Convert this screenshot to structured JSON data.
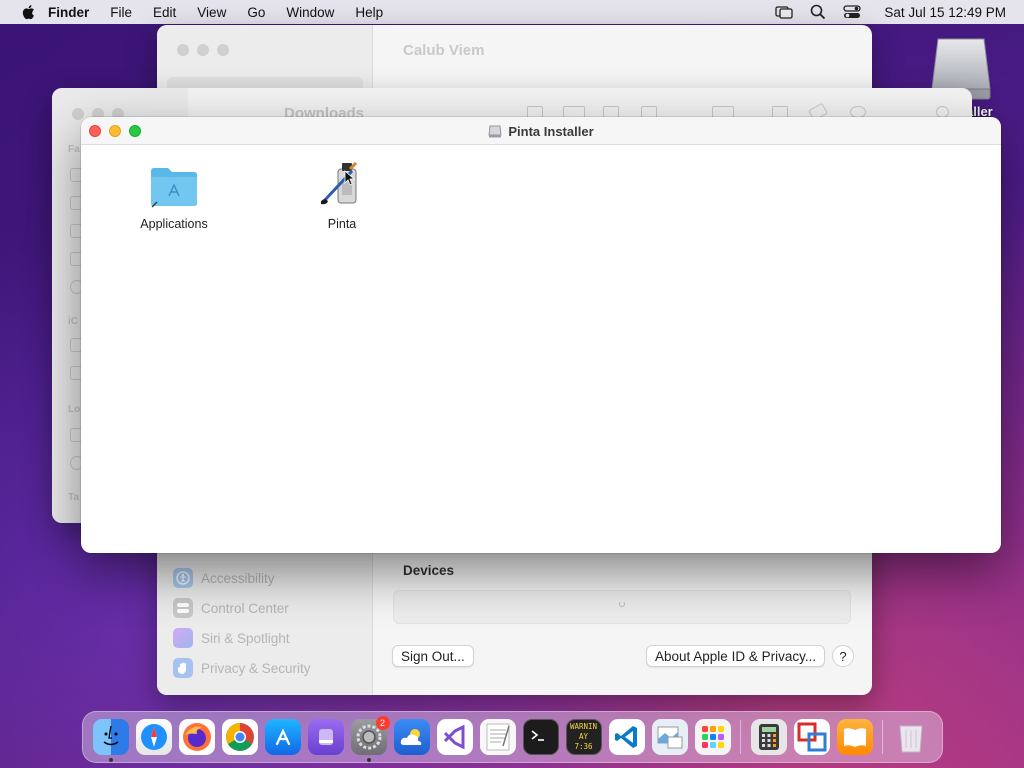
{
  "menubar": {
    "app_name": "Finder",
    "items": [
      "File",
      "Edit",
      "View",
      "Go",
      "Window",
      "Help"
    ],
    "clock": "Sat Jul 15  12:49 PM",
    "status_icons": [
      "screen-mirroring-icon",
      "spotlight-search-icon",
      "control-center-icon"
    ]
  },
  "desktop": {
    "drive_label": "aller"
  },
  "settings_window": {
    "title": "Calub Viem",
    "sidebar_items": [
      {
        "label": "Accessibility",
        "icon": "accessibility-icon",
        "color": "#4a90e2"
      },
      {
        "label": "Control Center",
        "icon": "control-center-icon",
        "color": "#8e8e93"
      },
      {
        "label": "Siri & Spotlight",
        "icon": "siri-icon",
        "color": "#b061e8"
      },
      {
        "label": "Privacy & Security",
        "icon": "hand-icon",
        "color": "#3a7ee8"
      }
    ],
    "devices_label": "Devices",
    "sign_out_label": "Sign Out...",
    "about_label": "About Apple ID & Privacy...",
    "help_label": "?"
  },
  "finder_window": {
    "title": "Downloads",
    "section_labels": [
      "Fa",
      "iC",
      "Lo",
      "Ta"
    ]
  },
  "installer_window": {
    "title": "Pinta Installer",
    "items": [
      {
        "label": "Applications",
        "icon": "applications-folder-icon"
      },
      {
        "label": "Pinta",
        "icon": "pinta-app-icon"
      }
    ]
  },
  "dock": {
    "apps": [
      {
        "name": "Finder",
        "icon": "finder-icon",
        "color": "#3a8ef0",
        "running": true
      },
      {
        "name": "Safari",
        "icon": "safari-icon",
        "color": "#1e90ff",
        "running": false
      },
      {
        "name": "Firefox",
        "icon": "firefox-icon",
        "color": "#ff7139",
        "running": false
      },
      {
        "name": "Chrome",
        "icon": "chrome-icon",
        "color": "#ffffff",
        "running": false
      },
      {
        "name": "App Store",
        "icon": "app-store-icon",
        "color": "#1c8ef9",
        "running": false
      },
      {
        "name": "Podcast",
        "icon": "podcast-icon",
        "color": "#7a4fd6",
        "running": false
      },
      {
        "name": "System Settings",
        "icon": "system-settings-icon",
        "color": "#8e8e93",
        "running": true,
        "badge": "2"
      },
      {
        "name": "Weather",
        "icon": "weather-icon",
        "color": "#2f80ed",
        "running": false
      },
      {
        "name": "Visual Studio",
        "icon": "visual-studio-icon",
        "color": "#ffffff",
        "running": false
      },
      {
        "name": "TextEdit",
        "icon": "textedit-icon",
        "color": "#f5f5f5",
        "running": false
      },
      {
        "name": "Terminal",
        "icon": "terminal-icon",
        "color": "#1a1a1a",
        "running": false
      },
      {
        "name": "Console",
        "icon": "console-icon",
        "color": "#222222",
        "running": false,
        "text": "WARNIN AY 7:36"
      },
      {
        "name": "VS Code",
        "icon": "vscode-icon",
        "color": "#ffffff",
        "running": false
      },
      {
        "name": "Preview",
        "icon": "preview-icon",
        "color": "#e8eef5",
        "running": false
      },
      {
        "name": "Launchpad",
        "icon": "launchpad-icon",
        "color": "#f0f0f0",
        "running": false
      },
      {
        "name": "Calculator",
        "icon": "calculator-icon",
        "color": "#e0e0e0",
        "running": false
      },
      {
        "name": "Parallels",
        "icon": "parallels-icon",
        "color": "#ffffff",
        "running": false
      },
      {
        "name": "Books",
        "icon": "books-icon",
        "color": "#ff9500",
        "running": false
      },
      {
        "name": "Trash",
        "icon": "trash-icon",
        "color": "#dcdcdc",
        "running": false
      }
    ]
  }
}
